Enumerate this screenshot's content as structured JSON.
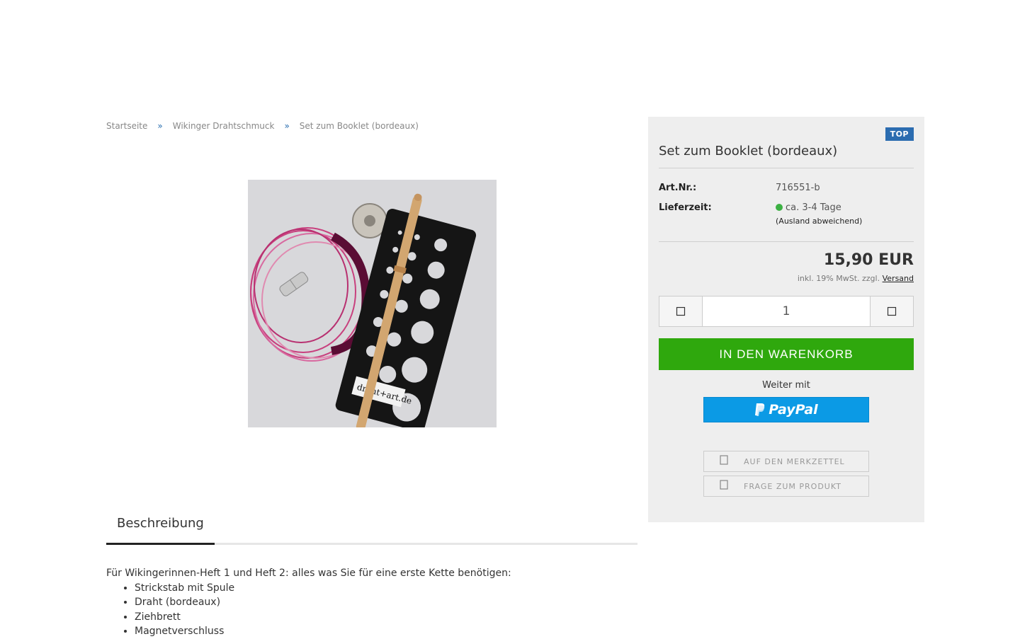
{
  "breadcrumb": {
    "home": "Startseite",
    "category": "Wikinger Drahtschmuck",
    "current": "Set zum Booklet (bordeaux)",
    "separator": "»"
  },
  "product": {
    "title": "Set zum Booklet (bordeaux)",
    "badge": "TOP",
    "image_watermark": "draht+art.de",
    "article_label": "Art.Nr.:",
    "article_value": "716551-b",
    "delivery_label": "Lieferzeit:",
    "delivery_value": "ca. 3-4 Tage",
    "delivery_note": "(Ausland abweichend)",
    "delivery_status_color": "#3cb043",
    "price": "15,90 EUR",
    "tax_note": "inkl. 19% MwSt. zzgl.",
    "shipping_link": "Versand",
    "quantity": "1",
    "add_to_cart": "IN DEN WARENKORB",
    "continue_with": "Weiter mit",
    "paypal_label": "PayPal",
    "wishlist": "AUF DEN MERKZETTEL",
    "question": "FRAGE ZUM PRODUKT"
  },
  "tabs": {
    "description": "Beschreibung"
  },
  "description": {
    "intro": "Für Wikingerinnen-Heft 1 und Heft 2: alles was Sie für eine erste Kette benötigen:",
    "items": [
      "Strickstab mit Spule",
      "Draht (bordeaux)",
      "Ziehbrett",
      "Magnetverschluss"
    ]
  },
  "colors": {
    "cart_button": "#2fa80d",
    "paypal": "#0b9ae5",
    "badge": "#2b6cb0"
  }
}
